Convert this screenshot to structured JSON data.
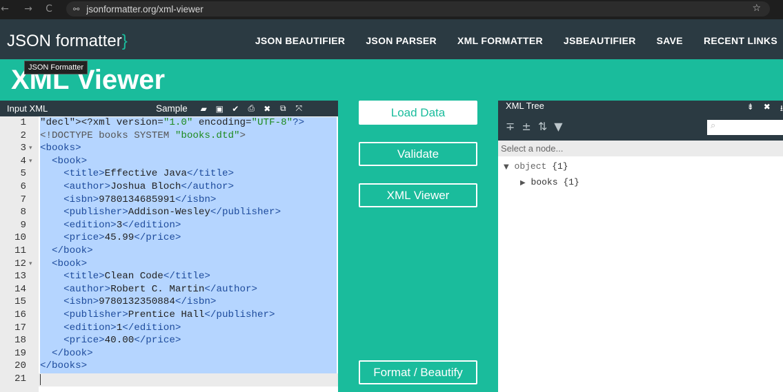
{
  "browser": {
    "url": "jsonformatter.org/xml-viewer",
    "back_icon": "←",
    "forward_icon": "→",
    "reload_icon": "C",
    "star_icon": "☆"
  },
  "header": {
    "logo": "JSON formatter",
    "logo_brace": "}",
    "nav": [
      "JSON BEAUTIFIER",
      "JSON PARSER",
      "XML FORMATTER",
      "JSBEAUTIFIER",
      "SAVE",
      "RECENT LINKS"
    ]
  },
  "page": {
    "title": "XML Viewer",
    "tooltip": "JSON Formatter"
  },
  "input_panel": {
    "label": "Input XML",
    "sample_label": "Sample",
    "lines": [
      "<?xml version=\"1.0\" encoding=\"UTF-8\"?>",
      "<!DOCTYPE books SYSTEM \"books.dtd\">",
      "<books>",
      "  <book>",
      "    <title>Effective Java</title>",
      "    <author>Joshua Bloch</author>",
      "    <isbn>9780134685991</isbn>",
      "    <publisher>Addison-Wesley</publisher>",
      "    <edition>3</edition>",
      "    <price>45.99</price>",
      "  </book>",
      "  <book>",
      "    <title>Clean Code</title>",
      "    <author>Robert C. Martin</author>",
      "    <isbn>9780132350884</isbn>",
      "    <publisher>Prentice Hall</publisher>",
      "    <edition>1</edition>",
      "    <price>40.00</price>",
      "  </book>",
      "</books>",
      ""
    ],
    "fold_lines": [
      3,
      4,
      12
    ]
  },
  "actions": {
    "load_data": "Load Data",
    "validate": "Validate",
    "xml_viewer": "XML Viewer",
    "format": "Format / Beautify"
  },
  "tree_panel": {
    "title": "XML Tree",
    "node_placeholder": "Select a node...",
    "root": "object",
    "root_count": "{1}",
    "child": "books",
    "child_count": "{1}"
  },
  "colors": {
    "accent": "#1abc9c",
    "header_bg": "#2b3a42",
    "selection": "#b5d5ff"
  }
}
